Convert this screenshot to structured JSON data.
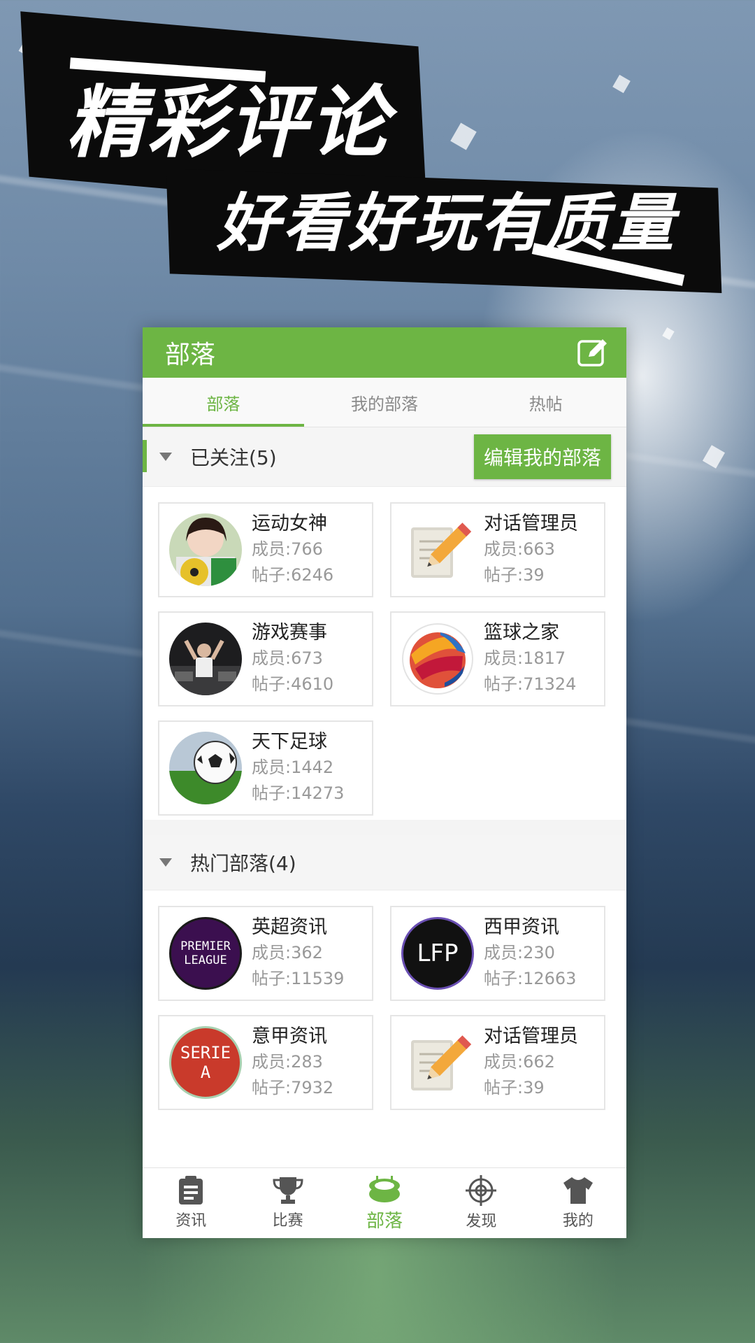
{
  "banner": {
    "title": "精彩评论",
    "subtitle": "好看好玩有质量"
  },
  "header": {
    "title": "部落",
    "edit_icon": "edit-icon"
  },
  "tabs": [
    {
      "label": "部落",
      "active": true
    },
    {
      "label": "我的部落",
      "active": false
    },
    {
      "label": "热帖",
      "active": false
    }
  ],
  "followed": {
    "title": "已关注(5)",
    "edit_button": "编辑我的部落",
    "items": [
      {
        "name": "运动女神",
        "members": "成员:766",
        "posts": "帖子:6246",
        "avatar": "photo-girl-football"
      },
      {
        "name": "对话管理员",
        "members": "成员:663",
        "posts": "帖子:39",
        "avatar": "pencil-notepad-icon"
      },
      {
        "name": "游戏赛事",
        "members": "成员:673",
        "posts": "帖子:4610",
        "avatar": "photo-esports"
      },
      {
        "name": "篮球之家",
        "members": "成员:1817",
        "posts": "帖子:71324",
        "avatar": "basketball-logo"
      },
      {
        "name": "天下足球",
        "members": "成员:1442",
        "posts": "帖子:14273",
        "avatar": "photo-soccer-ball"
      }
    ]
  },
  "hot": {
    "title": "热门部落(4)",
    "items": [
      {
        "name": "英超资讯",
        "members": "成员:362",
        "posts": "帖子:11539",
        "avatar": "premier-league-logo",
        "logo_text_1": "PREMIER",
        "logo_text_2": "LEAGUE"
      },
      {
        "name": "西甲资讯",
        "members": "成员:230",
        "posts": "帖子:12663",
        "avatar": "lfp-logo",
        "logo_text_1": "LFP"
      },
      {
        "name": "意甲资讯",
        "members": "成员:283",
        "posts": "帖子:7932",
        "avatar": "serie-a-logo",
        "logo_text_1": "SERIE",
        "logo_text_2": "A"
      },
      {
        "name": "对话管理员",
        "members": "成员:662",
        "posts": "帖子:39",
        "avatar": "pencil-notepad-icon"
      }
    ]
  },
  "bottom_nav": [
    {
      "label": "资讯",
      "icon": "clipboard-icon",
      "active": false
    },
    {
      "label": "比赛",
      "icon": "trophy-icon",
      "active": false
    },
    {
      "label": "部落",
      "icon": "stadium-icon",
      "active": true
    },
    {
      "label": "发现",
      "icon": "crosshair-icon",
      "active": false
    },
    {
      "label": "我的",
      "icon": "jersey-icon",
      "active": false
    }
  ],
  "colors": {
    "accent": "#6db544",
    "banner_black": "#0b0b0b"
  }
}
